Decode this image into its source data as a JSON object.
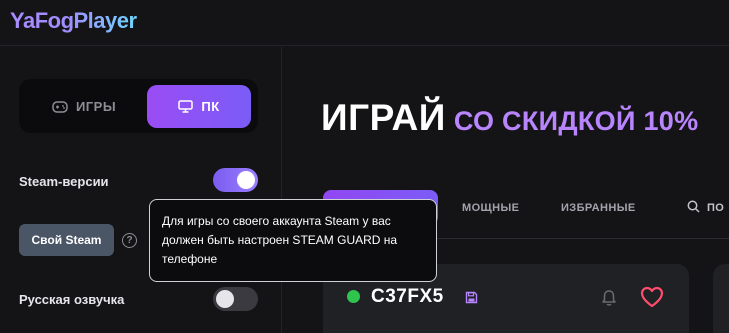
{
  "app": {
    "logo": "YaFogPlayer"
  },
  "sidebar": {
    "mode_switch": {
      "games_label": "ИГРЫ",
      "pc_label": "ПК",
      "active": "pc"
    },
    "settings": {
      "steam_versions_label": "Steam-версии",
      "steam_versions_on": true,
      "own_steam_button": "Свой Steam",
      "russian_voice_label": "Русская озвучка",
      "russian_voice_on": false
    }
  },
  "main": {
    "headline_main": "ИГРАЙ",
    "headline_accent": "СО СКИДКОЙ 10%",
    "tabs": {
      "active_label": "",
      "powerful": "МОЩНЫЕ",
      "favorites": "ИЗБРАННЫЕ",
      "search": "ПО"
    },
    "server_card": {
      "name": "C37FX5",
      "status": "online"
    }
  },
  "tooltip": {
    "text": "Для игры со своего аккаунта Steam у вас должен быть настроен STEAM GUARD на телефоне"
  },
  "colors": {
    "accent_purple": "#9a4cf5",
    "accent_text": "#b985ff",
    "online_green": "#2ec44d",
    "heart_red": "#ff4d6d"
  },
  "icons": [
    "gamepad-icon",
    "monitor-icon",
    "help-icon",
    "search-icon",
    "save-icon",
    "bell-icon",
    "heart-icon"
  ]
}
